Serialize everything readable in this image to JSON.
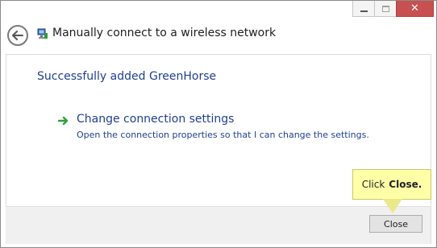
{
  "window": {
    "title": "Manually connect to a wireless network",
    "caption_buttons": {
      "minimize_icon": "minimize-icon",
      "maximize_icon": "maximize-icon",
      "close_icon": "close-icon",
      "close_glyph": "✕"
    }
  },
  "header": {
    "back_icon": "back-arrow-icon",
    "network_icon": "network-icon"
  },
  "content": {
    "status_message": "Successfully added GreenHorse",
    "option": {
      "icon": "green-arrow-icon",
      "title": "Change connection settings",
      "description": "Open the connection properties so that I can change the settings."
    }
  },
  "footer": {
    "close_label": "Close"
  },
  "tooltip": {
    "prefix": "Click",
    "emphasis": "Close."
  },
  "colors": {
    "link_blue": "#1f3f91",
    "close_red": "#c75050",
    "tooltip_yellow": "#ffffa8"
  }
}
